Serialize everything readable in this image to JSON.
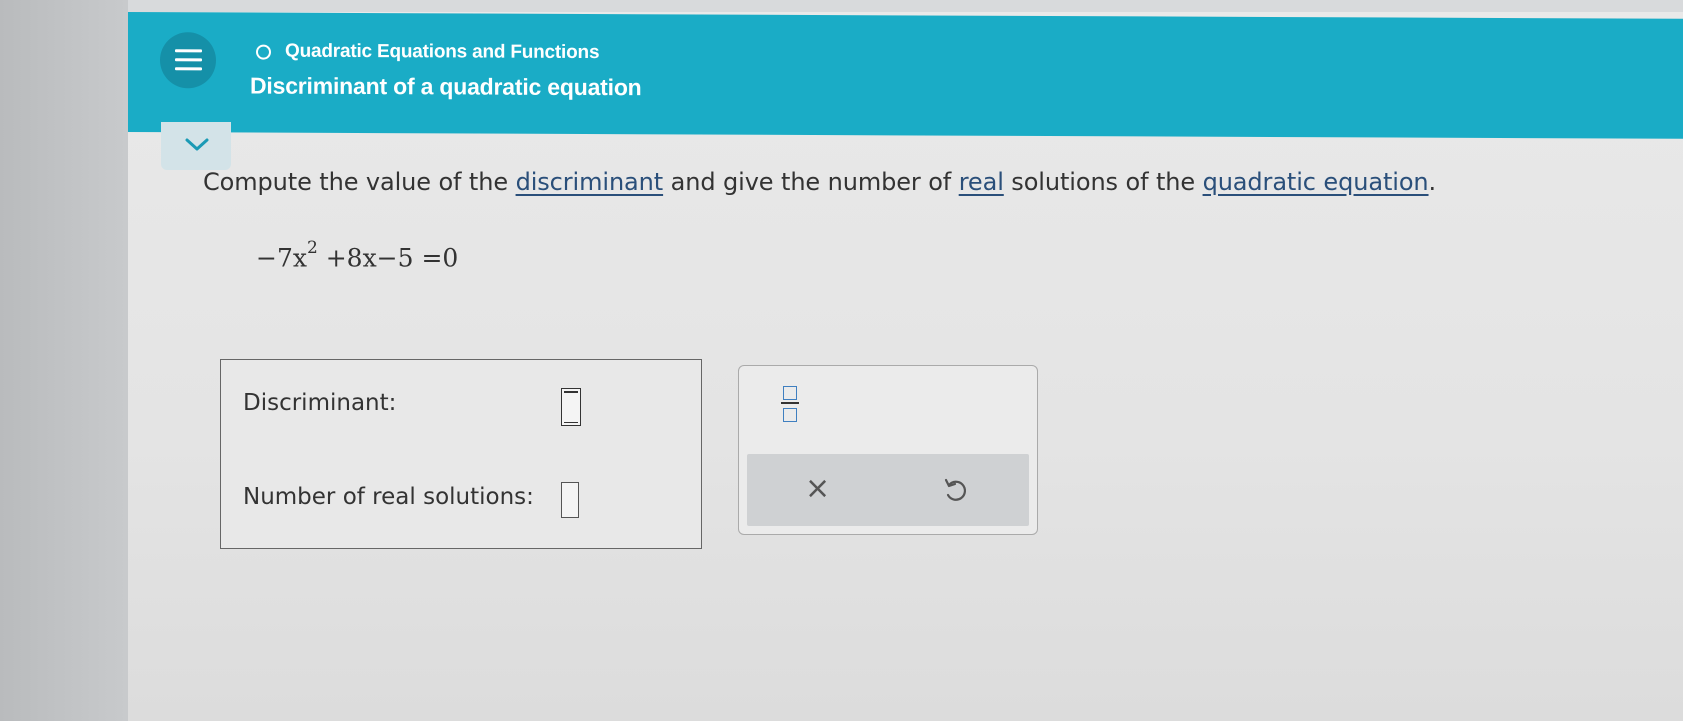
{
  "header": {
    "topic": "Quadratic Equations and Functions",
    "lesson_title": "Discriminant of a quadratic equation"
  },
  "question": {
    "prefix": "Compute the value of the ",
    "link_discriminant": "discriminant",
    "middle1": " and give the number of ",
    "link_real": "real",
    "middle2": " solutions of the ",
    "link_quadratic": "quadratic equation",
    "suffix": "."
  },
  "equation": {
    "term1": "−7x",
    "exponent": "2",
    "rest": " +8x−5 =0"
  },
  "answer": {
    "discriminant_label": "Discriminant:",
    "discriminant_value": "",
    "solutions_label": "Number of real solutions:",
    "solutions_value": ""
  },
  "tools": {
    "fraction_icon": "fraction-icon",
    "clear_icon": "×",
    "undo_icon": "undo-icon"
  },
  "colors": {
    "header": "#1aacc6",
    "link": "#2a4f7a",
    "frac_box": "#3f7fc0"
  }
}
